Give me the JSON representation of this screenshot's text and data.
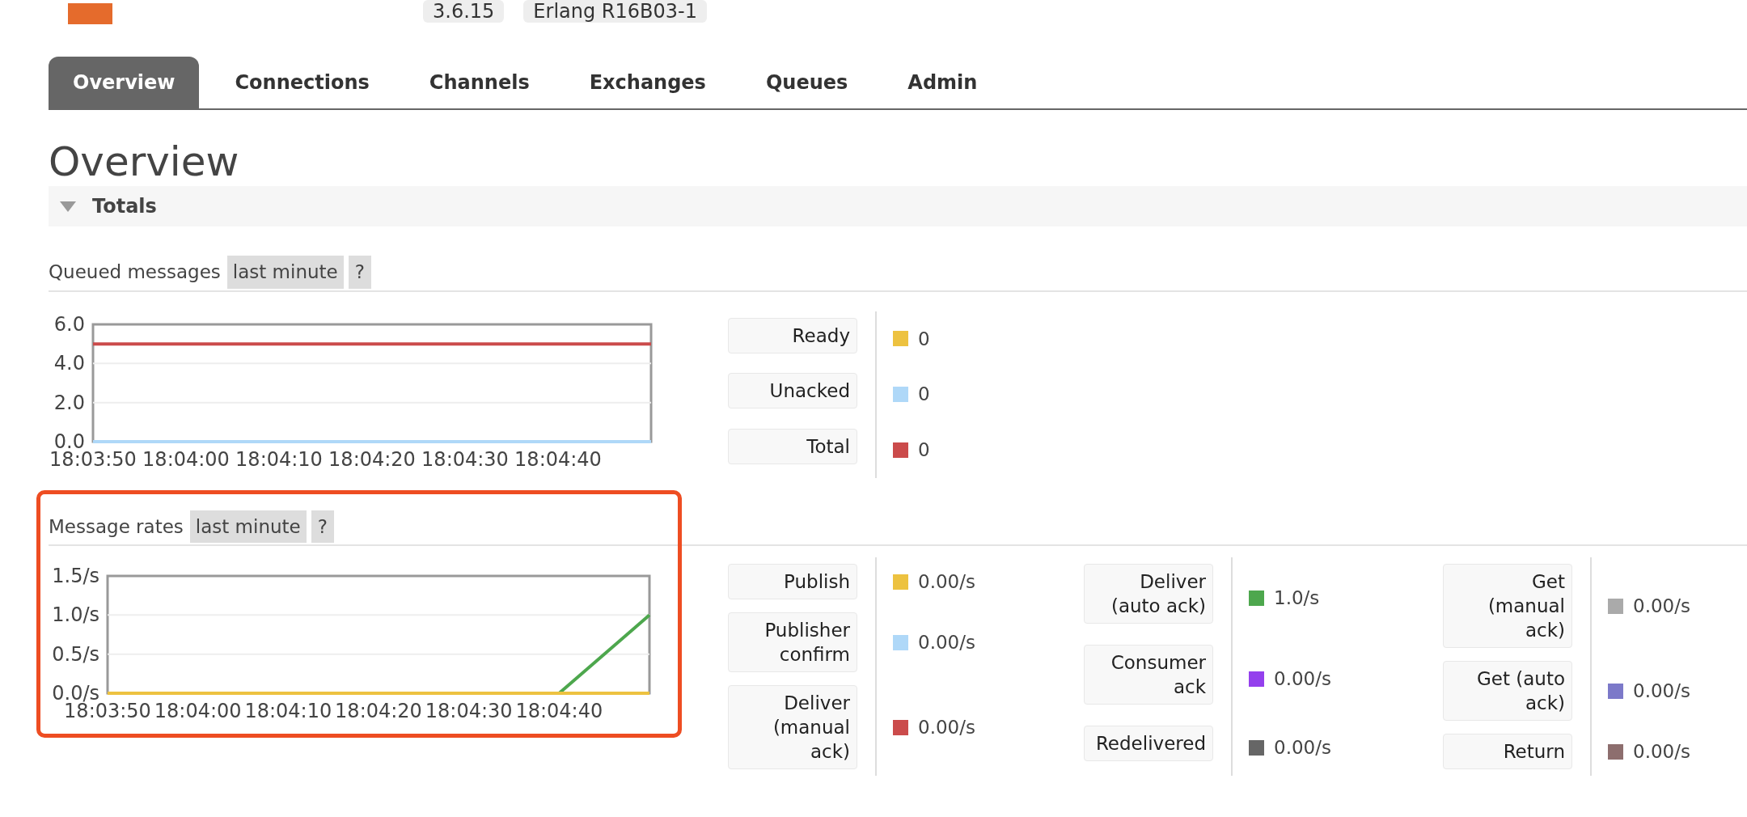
{
  "header": {
    "version": "3.6.15",
    "erlang": "Erlang R16B03-1"
  },
  "tabs": [
    {
      "label": "Overview",
      "selected": true
    },
    {
      "label": "Connections",
      "selected": false
    },
    {
      "label": "Channels",
      "selected": false
    },
    {
      "label": "Exchanges",
      "selected": false
    },
    {
      "label": "Queues",
      "selected": false
    },
    {
      "label": "Admin",
      "selected": false
    }
  ],
  "page_title": "Overview",
  "totals_section": {
    "title": "Totals",
    "expanded": true
  },
  "queued_messages": {
    "title": "Queued messages",
    "range": "last minute",
    "help": "?",
    "chart_data": {
      "type": "line",
      "categories": [
        "18:03:50",
        "18:04:00",
        "18:04:10",
        "18:04:20",
        "18:04:30",
        "18:04:40",
        null
      ],
      "ylim": [
        0,
        6
      ],
      "yticks": [
        {
          "value": 0,
          "label": "0.0"
        },
        {
          "value": 2,
          "label": "2.0"
        },
        {
          "value": 4,
          "label": "4.0"
        },
        {
          "value": 6,
          "label": "6.0"
        }
      ],
      "series": [
        {
          "color": "#afd8f8",
          "values": [
            0,
            0,
            0,
            0,
            0,
            0,
            0
          ]
        },
        {
          "color": "#cb4b4b",
          "values": [
            5,
            5,
            5,
            5,
            5,
            5,
            5
          ]
        }
      ]
    },
    "legend": [
      {
        "label": "Ready",
        "color": "#edc240",
        "value": "0"
      },
      {
        "label": "Unacked",
        "color": "#afd8f8",
        "value": "0"
      },
      {
        "label": "Total",
        "color": "#cb4b4b",
        "value": "0"
      }
    ]
  },
  "message_rates": {
    "title": "Message rates",
    "range": "last minute",
    "help": "?",
    "highlighted": true,
    "chart_data": {
      "type": "line",
      "categories": [
        "18:03:50",
        "18:04:00",
        "18:04:10",
        "18:04:20",
        "18:04:30",
        "18:04:40",
        null
      ],
      "ylim": [
        0,
        1.5
      ],
      "yticks": [
        {
          "value": 0,
          "label": "0.0/s"
        },
        {
          "value": 0.5,
          "label": "0.5/s"
        },
        {
          "value": 1,
          "label": "1.0/s"
        },
        {
          "value": 1.5,
          "label": "1.5/s"
        }
      ],
      "series": [
        {
          "color": "#4da74d",
          "values": [
            null,
            null,
            null,
            null,
            null,
            0,
            1
          ]
        },
        {
          "color": "#edc240",
          "values": [
            0,
            0,
            0,
            0,
            0,
            0,
            0
          ]
        }
      ]
    },
    "legend_columns": [
      [
        {
          "label": "Publish",
          "color": "#edc240",
          "value": "0.00/s"
        },
        {
          "label": "Publisher confirm",
          "color": "#afd8f8",
          "value": "0.00/s"
        },
        {
          "label": "Deliver (manual ack)",
          "color": "#cb4b4b",
          "value": "0.00/s"
        }
      ],
      [
        {
          "label": "Deliver (auto ack)",
          "color": "#4da74d",
          "value": "1.0/s"
        },
        {
          "label": "Consumer ack",
          "color": "#9440ed",
          "value": "0.00/s"
        },
        {
          "label": "Redelivered",
          "color": "#666666",
          "value": "0.00/s"
        }
      ],
      [
        {
          "label": "Get (manual ack)",
          "color": "#aaaaaa",
          "value": "0.00/s"
        },
        {
          "label": "Get (auto ack)",
          "color": "#7c79c9",
          "value": "0.00/s"
        },
        {
          "label": "Return",
          "color": "#8d6e6e",
          "value": "0.00/s"
        }
      ]
    ]
  }
}
